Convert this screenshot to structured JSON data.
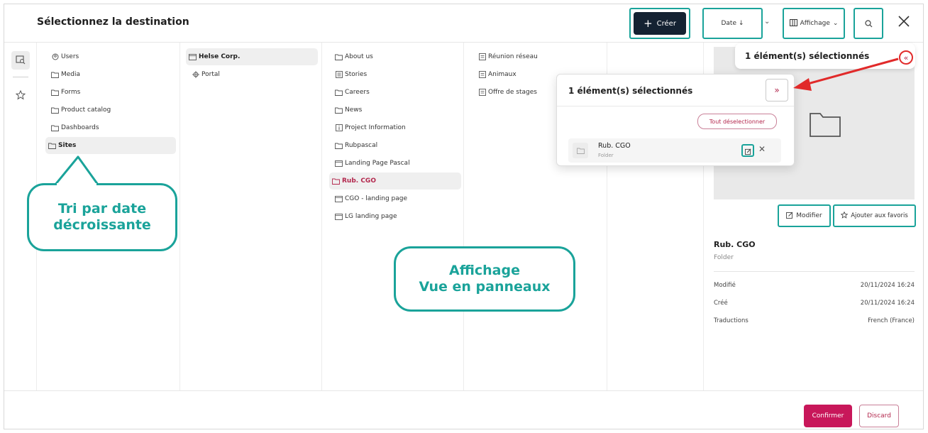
{
  "header": {
    "title": "Sélectionnez la destination",
    "create_label": "Créer",
    "date_label": "Date",
    "affichage_label": "Affichage"
  },
  "columns": {
    "col1": [
      "Users",
      "Media",
      "Forms",
      "Product catalog",
      "Dashboards",
      "Sites"
    ],
    "col2": [
      "Helse Corp.",
      "Portal"
    ],
    "col3": [
      "About us",
      "Stories",
      "Careers",
      "News",
      "Project Information",
      "Rubpascal",
      "Landing Page Pascal",
      "Rub. CGO",
      "CGO - landing page",
      "LG landing page"
    ],
    "col4": [
      "Réunion réseau",
      "Animaux",
      "Offre de stages"
    ]
  },
  "selection": {
    "tab_label": "1 élément(s) sélectionnés",
    "popover_title": "1 élément(s) sélectionnés",
    "deselect_all": "Tout déselectionner",
    "item_name": "Rub. CGO",
    "item_type": "Folder"
  },
  "detail": {
    "modify_label": "Modifier",
    "favorites_label": "Ajouter aux favoris",
    "name": "Rub. CGO",
    "type": "Folder",
    "rows": [
      {
        "label": "Modifié",
        "value": "20/11/2024 16:24"
      },
      {
        "label": "Créé",
        "value": "20/11/2024 16:24"
      },
      {
        "label": "Traductions",
        "value": "French (France)"
      }
    ]
  },
  "footer": {
    "confirm_label": "Confirmer",
    "discard_label": "Discard"
  },
  "callouts": {
    "tri_line1": "Tri par date",
    "tri_line2": "décroissante",
    "aff_line1": "Affichage",
    "aff_line2": "Vue en panneaux"
  },
  "colors": {
    "accent_teal": "#1aa39a",
    "brand_primary": "#c8175a",
    "dark_button": "#142232",
    "arrow_red": "#e12a2a"
  }
}
